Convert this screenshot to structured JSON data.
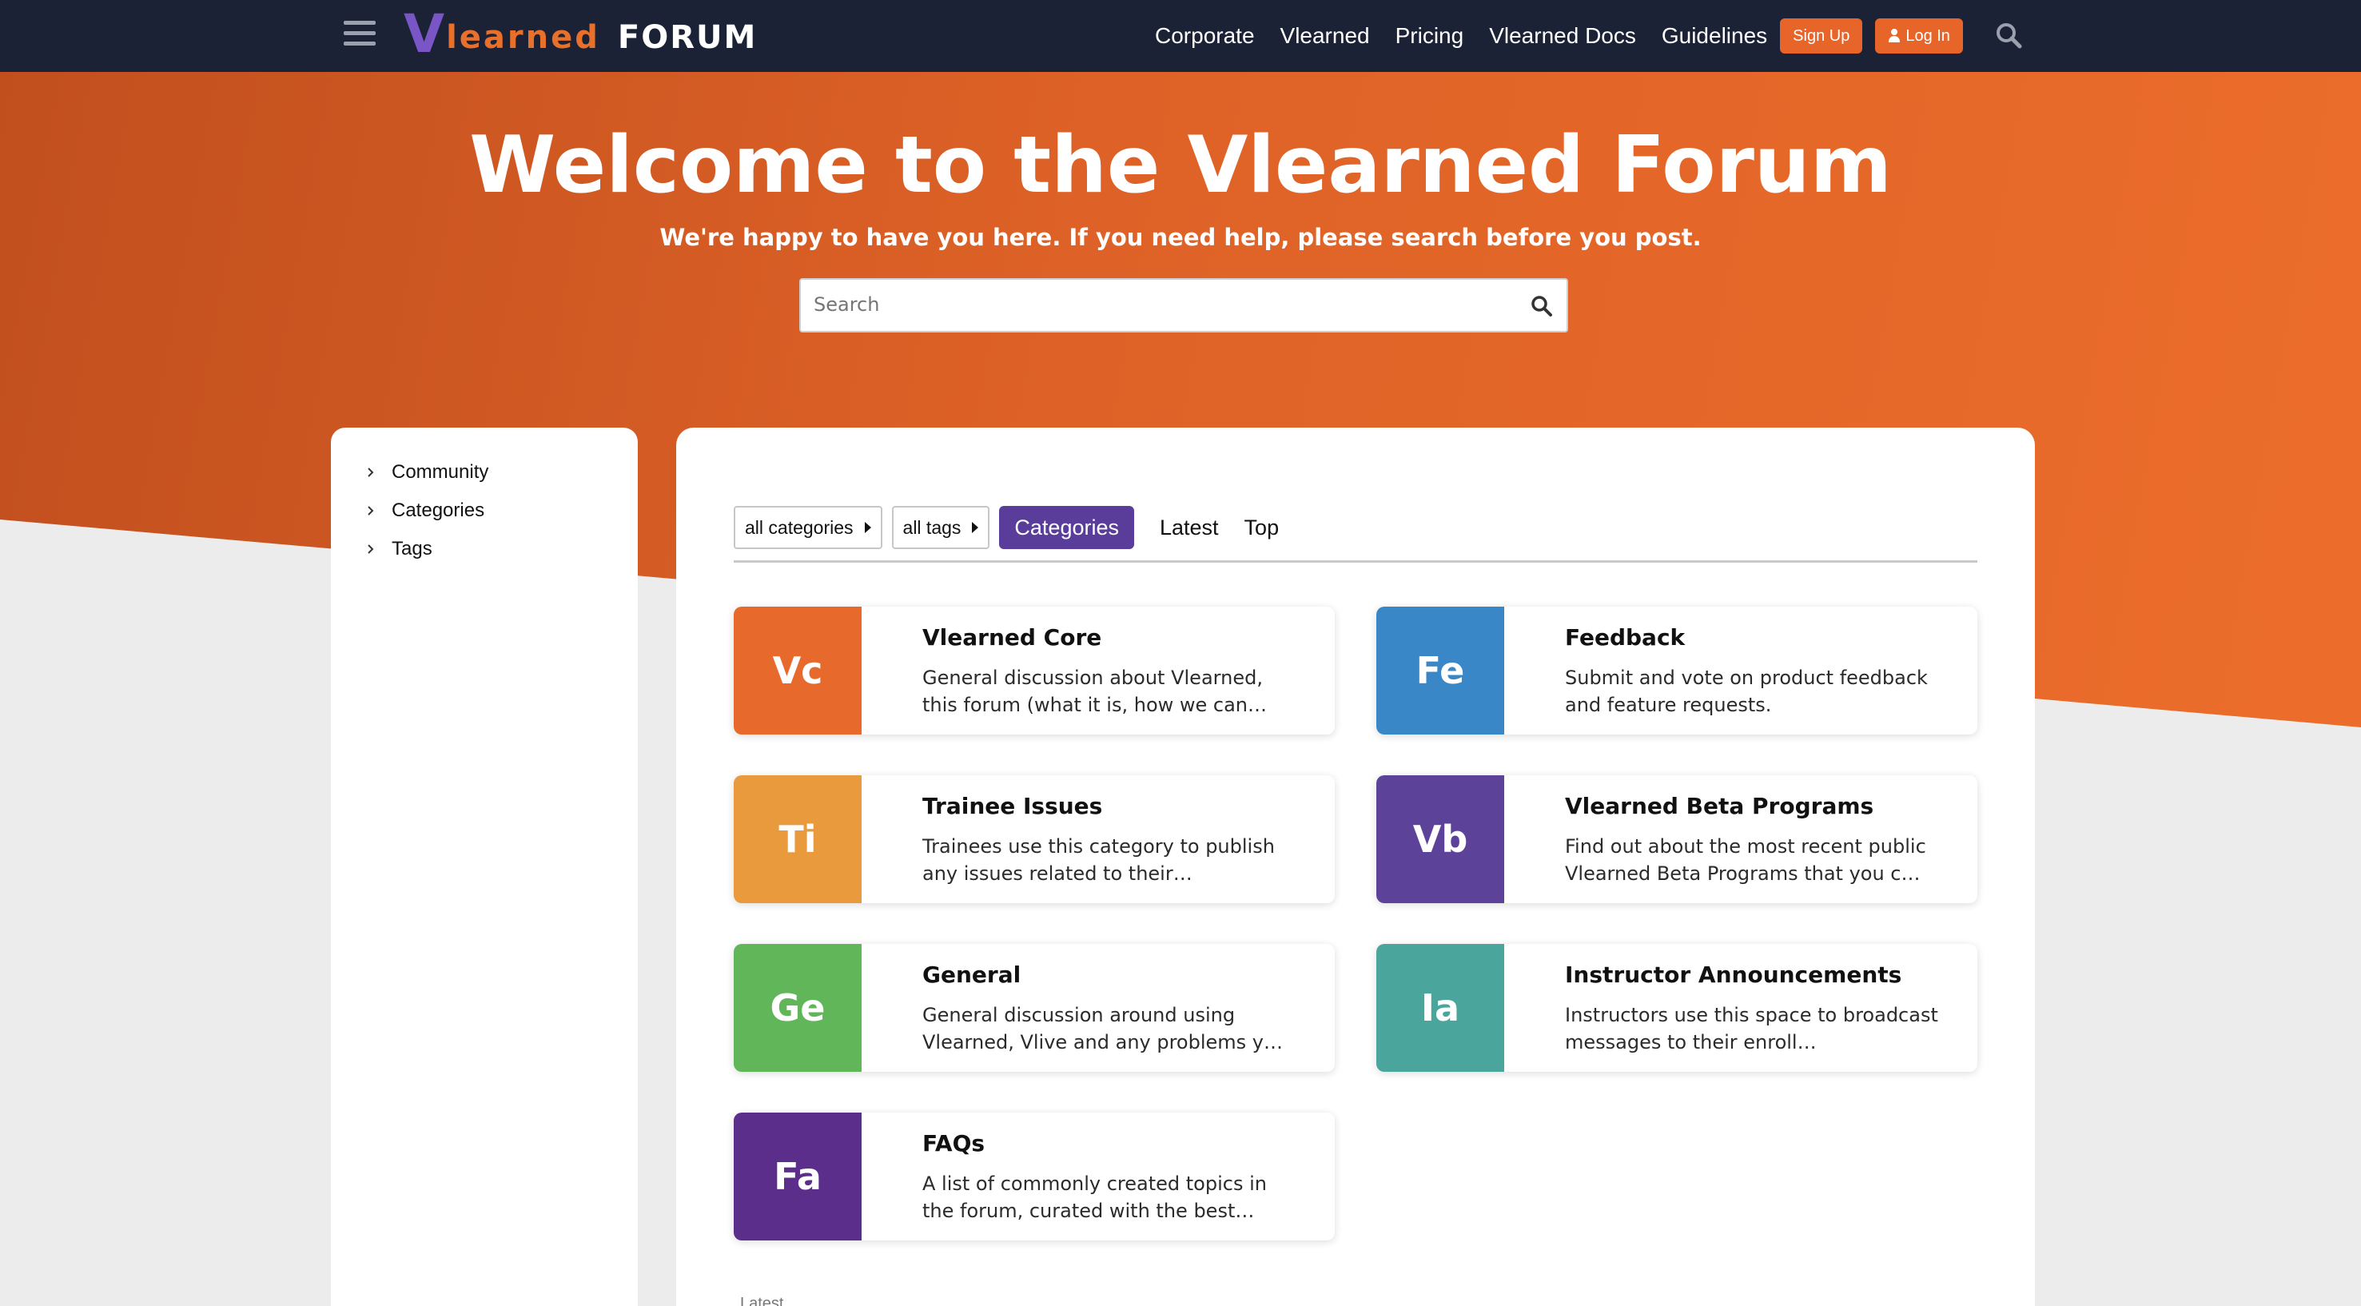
{
  "header": {
    "logo": {
      "v": "V",
      "learned": "learned",
      "forum": "FORUM"
    },
    "nav": [
      "Corporate",
      "Vlearned",
      "Pricing",
      "Vlearned Docs",
      "Guidelines"
    ],
    "signup_label": "Sign Up",
    "login_label": "Log In"
  },
  "hero": {
    "title": "Welcome to the Vlearned Forum",
    "subtitle": "We're happy to have you here. If you need help, please search before you post.",
    "search_placeholder": "Search"
  },
  "sidebar": {
    "items": [
      {
        "label": "Community"
      },
      {
        "label": "Categories"
      },
      {
        "label": "Tags"
      }
    ]
  },
  "main": {
    "filters": {
      "categories": "all categories",
      "tags": "all tags"
    },
    "tabs": [
      {
        "label": "Categories",
        "active": true
      },
      {
        "label": "Latest",
        "active": false
      },
      {
        "label": "Top",
        "active": false
      }
    ],
    "categories": [
      {
        "abbr": "Vc",
        "title": "Vlearned Core",
        "desc": "General discussion about Vlearned, this forum (what it is, how we can…",
        "color": "#e8692c"
      },
      {
        "abbr": "Fe",
        "title": "Feedback",
        "desc": "Submit and vote on product feedback and feature requests.",
        "color": "#3a87c8"
      },
      {
        "abbr": "Ti",
        "title": "Trainee Issues",
        "desc": "Trainees use this category to publish any issues related to their…",
        "color": "#e99a3c"
      },
      {
        "abbr": "Vb",
        "title": "Vlearned Beta Programs",
        "desc": "Find out about the most recent public Vlearned Beta Programs that you c…",
        "color": "#5c4399"
      },
      {
        "abbr": "Ge",
        "title": "General",
        "desc": "General discussion around using Vlearned, Vlive and any problems y…",
        "color": "#61b65a"
      },
      {
        "abbr": "Ia",
        "title": "Instructor Announcements",
        "desc": "Instructors use this space to broadcast messages to their enroll…",
        "color": "#4aa69c"
      },
      {
        "abbr": "Fa",
        "title": "FAQs",
        "desc": "A list of commonly created topics in the forum, curated with the best…",
        "color": "#5b2e8c"
      }
    ],
    "footer_label": "Latest"
  }
}
